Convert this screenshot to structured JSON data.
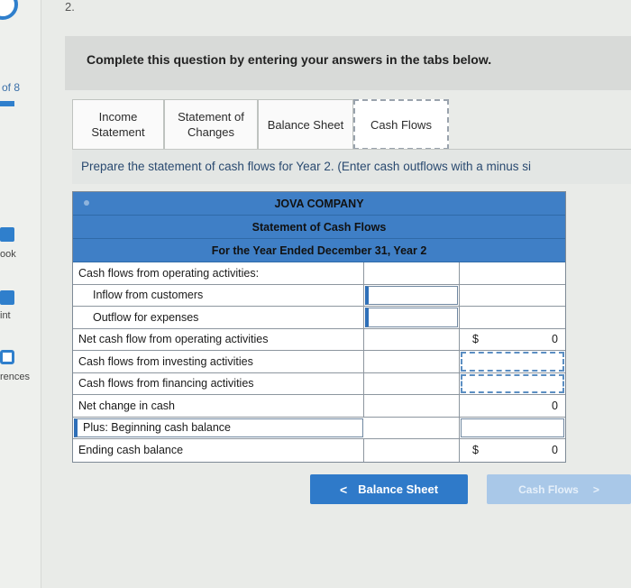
{
  "sidebar": {
    "page_indicator": "of 8",
    "items": [
      {
        "label": "ook",
        "icon": "book-icon"
      },
      {
        "label": "int",
        "icon": "print-icon"
      },
      {
        "label": "rences",
        "icon": "references-icon"
      }
    ]
  },
  "question_number": "2.",
  "instruction": "Complete this question by entering your answers in the tabs below.",
  "tabs": [
    {
      "label_line1": "Income",
      "label_line2": "Statement",
      "active": false
    },
    {
      "label_line1": "Statement of",
      "label_line2": "Changes",
      "active": false
    },
    {
      "label_line1": "Balance Sheet",
      "label_line2": "",
      "active": false
    },
    {
      "label_line1": "Cash Flows",
      "label_line2": "",
      "active": true
    }
  ],
  "prompt": "Prepare the statement of cash flows for Year 2. (Enter cash outflows with a minus si",
  "statement": {
    "company": "JOVA COMPANY",
    "title": "Statement of Cash Flows",
    "period": "For the Year Ended December 31, Year 2",
    "rows": [
      {
        "label": "Cash flows from operating activities:",
        "c1": "",
        "c2_symbol": "",
        "c2_value": ""
      },
      {
        "label": "Inflow from customers",
        "c1": "",
        "c2_symbol": "",
        "c2_value": ""
      },
      {
        "label": "Outflow for expenses",
        "c1": "",
        "c2_symbol": "",
        "c2_value": ""
      },
      {
        "label": "Net cash flow from operating activities",
        "c1": "",
        "c2_symbol": "$",
        "c2_value": "0"
      },
      {
        "label": "Cash flows from investing activities",
        "c1": "",
        "c2_symbol": "",
        "c2_value": ""
      },
      {
        "label": "Cash flows from financing activities",
        "c1": "",
        "c2_symbol": "",
        "c2_value": ""
      },
      {
        "label": "Net change in cash",
        "c1": "",
        "c2_symbol": "",
        "c2_value": "0"
      },
      {
        "label": "Plus: Beginning cash balance",
        "c1": "",
        "c2_symbol": "",
        "c2_value": ""
      },
      {
        "label": "Ending cash balance",
        "c1": "",
        "c2_symbol": "$",
        "c2_value": "0"
      }
    ]
  },
  "nav": {
    "prev_label": "Balance Sheet",
    "prev_chevron": "<",
    "next_label": "Cash Flows",
    "next_chevron": ">"
  },
  "colors": {
    "accent": "#2f7ac9",
    "header_blue": "#3f7fc6",
    "prompt_text": "#2a4a70"
  }
}
